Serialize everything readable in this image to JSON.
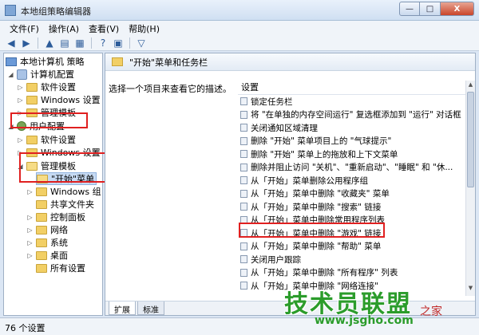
{
  "window": {
    "title": "本地组策略编辑器",
    "buttons": [
      "—",
      "□",
      "X"
    ]
  },
  "menu": [
    "文件(F)",
    "操作(A)",
    "查看(V)",
    "帮助(H)"
  ],
  "toolbar_icons": [
    "back-icon",
    "forward-icon",
    "up-icon",
    "show-hide-tree-icon",
    "export-icon",
    "help-icon",
    "properties-icon",
    "filter-icon"
  ],
  "tree": {
    "root": "本地计算机 策略",
    "computer_config": "计算机配置",
    "cc_software": "软件设置",
    "cc_windows": "Windows 设置",
    "cc_admin": "管理模板",
    "user_config": "用户配置",
    "uc_software": "软件设置",
    "uc_windows": "Windows 设置",
    "uc_admin": "管理模板",
    "start_menu": "\"开始\"菜单",
    "windows_components": "Windows 组",
    "shared_folders": "共享文件夹",
    "control_panel": "控制面板",
    "network": "网络",
    "system": "系统",
    "desktop": "桌面",
    "all_settings": "所有设置"
  },
  "right_panel": {
    "header": "\"开始\"菜单和任务栏",
    "description": "选择一个项目来查看它的描述。",
    "column_header": "设置",
    "settings": [
      "锁定任务栏",
      "将 \"在单独的内存空间运行\" 复选框添加到 \"运行\" 对话框",
      "关闭通知区域清理",
      "删除 \"开始\" 菜单项目上的 \"气球提示\"",
      "删除 \"开始\" 菜单上的拖放和上下文菜单",
      "删除并阻止访问 \"关机\"、\"重新启动\"、\"睡眠\" 和 \"休...",
      "从「开始」菜单删除公用程序组",
      "从「开始」菜单中删除 \"收藏夹\" 菜单",
      "从「开始」菜单中删除 \"搜索\" 链接",
      "从「开始」菜单中删除常用程序列表",
      "从「开始」菜单中删除 \"游戏\" 链接",
      "从「开始」菜单中删除 \"帮助\" 菜单",
      "关闭用户跟踪",
      "从「开始」菜单中删除 \"所有程序\" 列表",
      "从「开始」菜单中删除 \"网络连接\""
    ],
    "tabs": [
      "扩展",
      "标准"
    ]
  },
  "status": "76 个设置",
  "watermark": {
    "title": "技术员联盟",
    "url": "www.jsgho.com",
    "tag": "之家"
  }
}
